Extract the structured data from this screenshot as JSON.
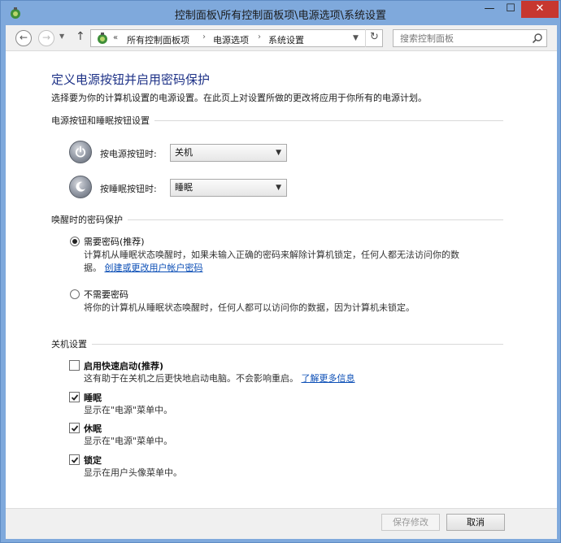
{
  "window": {
    "title": "控制面板\\所有控制面板项\\电源选项\\系统设置",
    "minimize": "—",
    "maximize": "☐",
    "close": "✕"
  },
  "nav": {
    "back": "←",
    "forward": "→",
    "history": "▼",
    "up": "↑",
    "chevron": "«",
    "breadcrumbs": [
      "所有控制面板项",
      "电源选项",
      "系统设置"
    ],
    "separator": "›",
    "dropdown": "▼",
    "refresh": "↻",
    "search_placeholder": "搜索控制面板"
  },
  "page": {
    "title": "定义电源按钮并启用密码保护",
    "description": "选择要为你的计算机设置的电源设置。在此页上对设置所做的更改将应用于你所有的电源计划。"
  },
  "power_section": {
    "header": "电源按钮和睡眠按钮设置",
    "power_button_label": "按电源按钮时:",
    "power_button_value": "关机",
    "sleep_button_label": "按睡眠按钮时:",
    "sleep_button_value": "睡眠",
    "chevron": "▼"
  },
  "wake_section": {
    "header": "唤醒时的密码保护",
    "require_label": "需要密码(推荐)",
    "require_desc_line1": "计算机从睡眠状态唤醒时，如果未输入正确的密码来解除计算机锁定，任何人都无法访问你的数",
    "require_desc_line2": "据。",
    "require_link": "创建或更改用户帐户密码",
    "no_password_label": "不需要密码",
    "no_password_desc": "将你的计算机从睡眠状态唤醒时，任何人都可以访问你的数据，因为计算机未锁定。"
  },
  "shutdown_section": {
    "header": "关机设置",
    "items": [
      {
        "label": "启用快速启动(推荐)",
        "desc": "这有助于在关机之后更快地启动电脑。不会影响重启。",
        "link": "了解更多信息",
        "checked": false
      },
      {
        "label": "睡眠",
        "desc": "显示在\"电源\"菜单中。",
        "checked": true
      },
      {
        "label": "休眠",
        "desc": "显示在\"电源\"菜单中。",
        "checked": true
      },
      {
        "label": "锁定",
        "desc": "显示在用户头像菜单中。",
        "checked": true
      }
    ]
  },
  "footer": {
    "save": "保存修改",
    "cancel": "取消"
  }
}
